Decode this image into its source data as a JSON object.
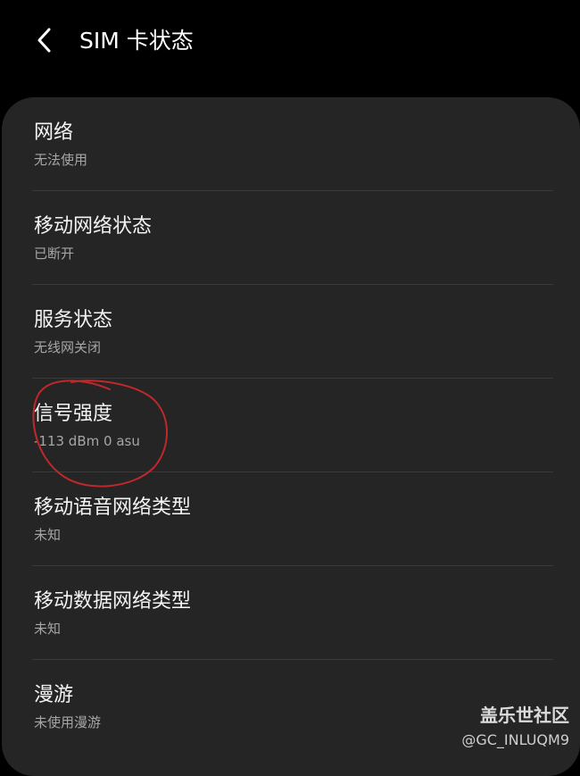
{
  "header": {
    "title": "SIM 卡状态",
    "back_icon": "chevron-left-icon"
  },
  "rows": [
    {
      "title": "网络",
      "value": "无法使用"
    },
    {
      "title": "移动网络状态",
      "value": "已断开"
    },
    {
      "title": "服务状态",
      "value": "无线网关闭"
    },
    {
      "title": "信号强度",
      "value": "-113 dBm 0 asu"
    },
    {
      "title": "移动语音网络类型",
      "value": "未知"
    },
    {
      "title": "移动数据网络类型",
      "value": "未知"
    },
    {
      "title": "漫游",
      "value": "未使用漫游"
    }
  ],
  "annotation": {
    "color": "#c0282b"
  },
  "watermark": {
    "brand": "盖乐世社区",
    "user": "@GC_INLUQM9"
  },
  "colors": {
    "background": "#000000",
    "card": "#252525",
    "divider": "#3a3a3a",
    "title_text": "#f4f4f4",
    "value_text": "#a6a6a6"
  }
}
